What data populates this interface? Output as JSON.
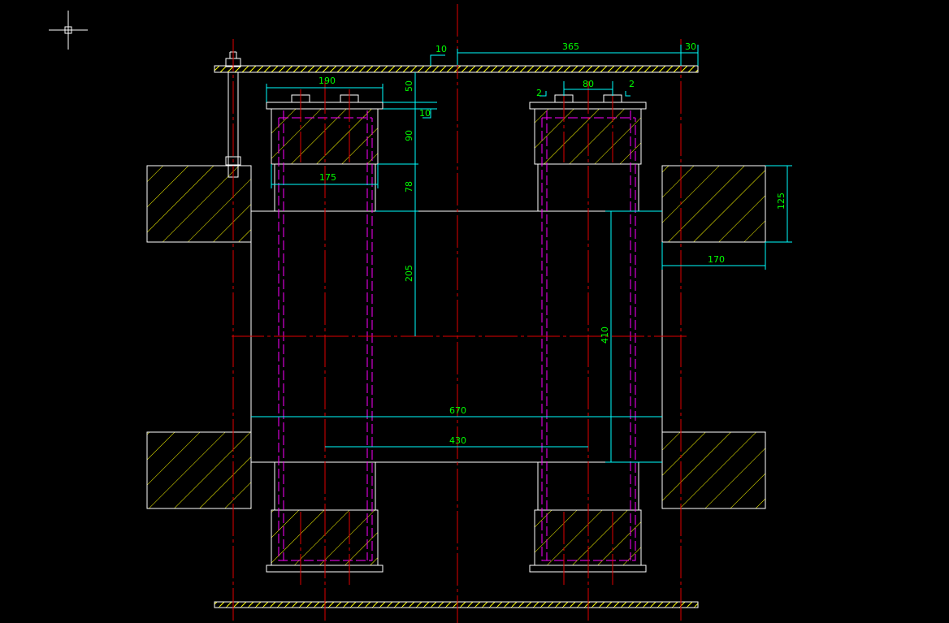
{
  "colors": {
    "background": "#000000",
    "outline": "#ffffff",
    "centerline": "#e00000",
    "dimension": "#00ffff",
    "dimension_text": "#00ff00",
    "hatch": "#ffff00",
    "hidden_line": "#ff00ff"
  },
  "dimensions": {
    "d_10_top": "10",
    "d_365": "365",
    "d_30": "30",
    "d_190": "190",
    "d_50": "50",
    "d_10_side": "10",
    "d_90": "90",
    "d_175": "175",
    "d_78": "78",
    "d_205": "205",
    "d_2_left": "2",
    "d_80": "80",
    "d_2_right": "2",
    "d_125": "125",
    "d_170": "170",
    "d_410": "410",
    "d_670": "670",
    "d_430": "430"
  },
  "icons": {
    "cursor": "crosshair-cursor-icon"
  }
}
